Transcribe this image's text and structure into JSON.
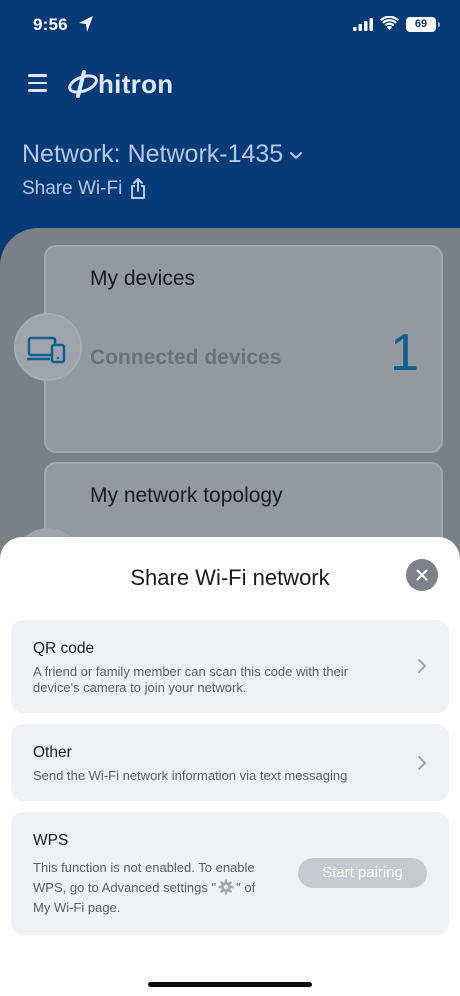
{
  "status_bar": {
    "time": "9:56",
    "battery": "69"
  },
  "header": {
    "brand": "hitron",
    "network_label": "Network: Network-1435",
    "share_label": "Share Wi-Fi"
  },
  "cards": {
    "devices": {
      "title": "My devices",
      "subtitle": "Connected devices",
      "count": "1"
    },
    "topology": {
      "title": "My network topology"
    }
  },
  "sheet": {
    "title": "Share Wi-Fi network",
    "options": {
      "qr": {
        "title": "QR code",
        "description": "A friend or family member can scan this code with their device's camera to join your network."
      },
      "other": {
        "title": "Other",
        "description": "Send the Wi-Fi network information via text messaging"
      },
      "wps": {
        "title": "WPS",
        "desc_before": "This function is not enabled. To enable WPS, go to  Advanced settings \"",
        "desc_after": "\" of My Wi-Fi page.",
        "button_label": "Start pairing"
      }
    }
  },
  "colors": {
    "header_blue": "#063a78",
    "count_blue": "#115f8e",
    "disabled_button": "#c6c9ce"
  },
  "icons": [
    "location-arrow-icon",
    "signal-icon",
    "wifi-icon",
    "battery-icon",
    "menu-icon",
    "hitron-logo-icon",
    "chevron-down-icon",
    "share-icon",
    "devices-icon",
    "close-icon",
    "chevron-right-icon",
    "gear-icon"
  ]
}
